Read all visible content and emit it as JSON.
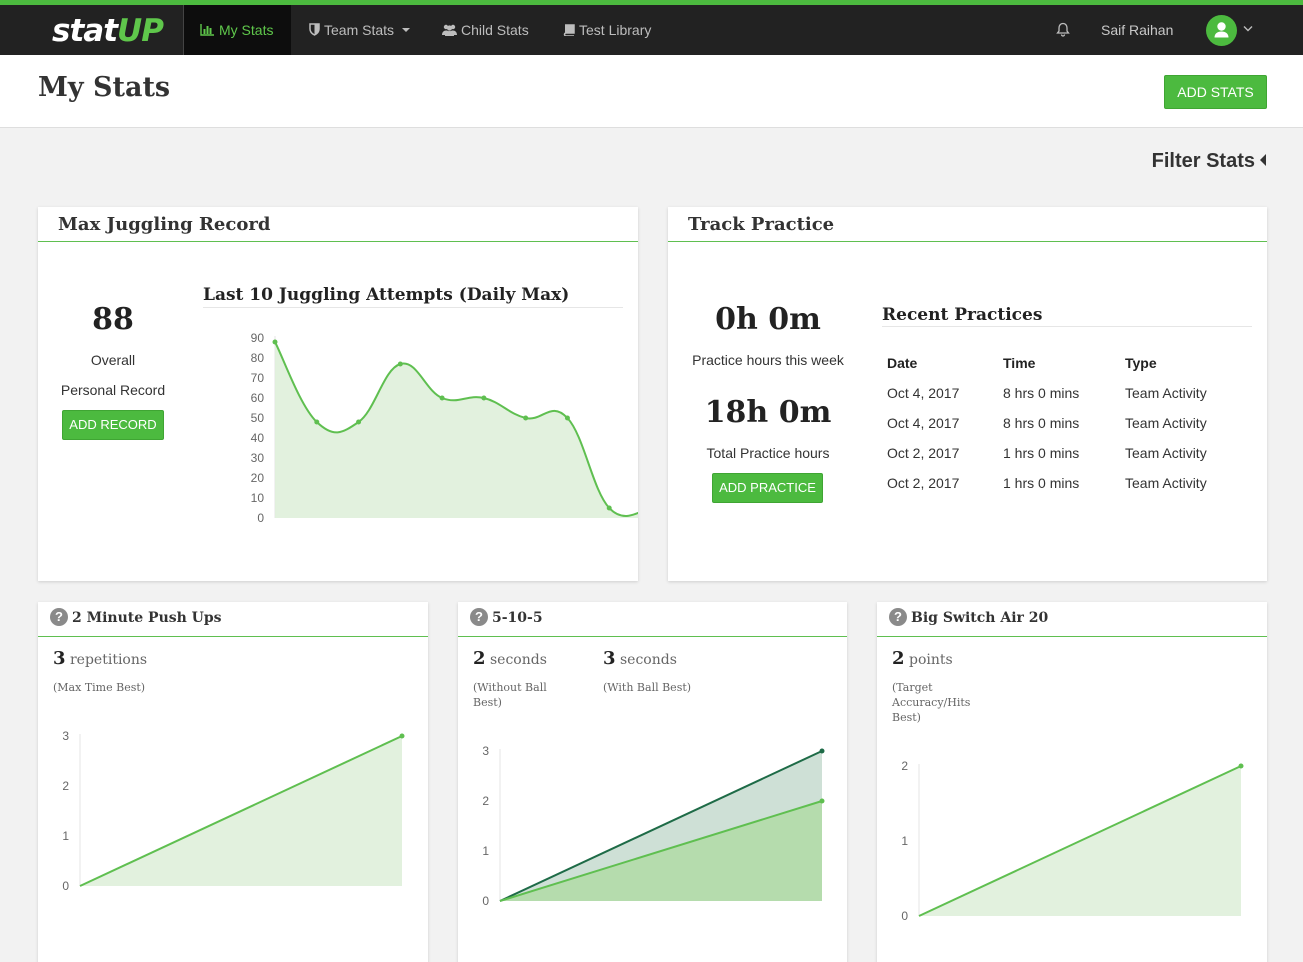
{
  "brand": {
    "part1": "stat",
    "part2": "UP"
  },
  "nav": {
    "my_stats": "My Stats",
    "team_stats": "Team Stats",
    "child_stats": "Child Stats",
    "test_library": "Test Library"
  },
  "user": {
    "name": "Saif Raihan"
  },
  "page": {
    "title": "My Stats",
    "add_stats": "ADD STATS",
    "filter": "Filter Stats"
  },
  "juggling": {
    "title": "Max Juggling Record",
    "record": "88",
    "label1": "Overall",
    "label2": "Personal Record",
    "button": "ADD RECORD",
    "chart_title": "Last 10 Juggling Attempts (Daily Max)"
  },
  "practice": {
    "title": "Track Practice",
    "week_value": "0h 0m",
    "week_label": "Practice hours this week",
    "total_value": "18h 0m",
    "total_label": "Total Practice hours",
    "button": "ADD PRACTICE",
    "recent_title": "Recent Practices",
    "columns": [
      "Date",
      "Time",
      "Type"
    ],
    "rows": [
      [
        "Oct 4, 2017",
        "8 hrs 0 mins",
        "Team Activity"
      ],
      [
        "Oct 4, 2017",
        "8 hrs 0 mins",
        "Team Activity"
      ],
      [
        "Oct 2, 2017",
        "1 hrs 0 mins",
        "Team Activity"
      ],
      [
        "Oct 2, 2017",
        "1 hrs 0 mins",
        "Team Activity"
      ]
    ]
  },
  "pushups": {
    "title": "2 Minute Push Ups",
    "value": "3",
    "unit": "repetitions",
    "note": "(Max Time Best)"
  },
  "fivetenfive": {
    "title": "5-10-5",
    "value1": "2",
    "unit1": "seconds",
    "note1": "(Without Ball Best)",
    "value2": "3",
    "unit2": "seconds",
    "note2": "(With Ball Best)"
  },
  "bigswitch": {
    "title": "Big Switch Air 20",
    "value": "2",
    "unit": "points",
    "note": "(Target Accuracy/Hits Best)"
  },
  "colors": {
    "accent": "#4cba3f",
    "fill": "#dff0da",
    "dark_series": "#1e6b47"
  },
  "chart_data": [
    {
      "type": "area",
      "title": "Last 10 Juggling Attempts (Daily Max)",
      "x": [
        1,
        2,
        3,
        4,
        5,
        6,
        7,
        8,
        9,
        10
      ],
      "values": [
        88,
        48,
        48,
        77,
        60,
        60,
        50,
        50,
        5,
        5
      ],
      "ylim": [
        0,
        90
      ],
      "yticks": [
        0,
        10,
        20,
        30,
        40,
        50,
        60,
        70,
        80,
        90
      ],
      "grid": false,
      "smooth": true
    },
    {
      "type": "area",
      "chart": "pushups",
      "x": [
        1,
        2
      ],
      "values": [
        0,
        3
      ],
      "ylim": [
        0,
        3
      ],
      "yticks": [
        0,
        1,
        2,
        3
      ]
    },
    {
      "type": "area",
      "chart": "fivetenfive",
      "x": [
        1,
        2
      ],
      "series": [
        {
          "values": [
            0,
            3
          ]
        },
        {
          "values": [
            0,
            2
          ]
        }
      ],
      "ylim": [
        0,
        3
      ],
      "yticks": [
        0,
        1,
        2,
        3
      ]
    },
    {
      "type": "area",
      "chart": "bigswitch",
      "x": [
        1,
        2
      ],
      "values": [
        0,
        2
      ],
      "ylim": [
        0,
        2
      ],
      "yticks": [
        0,
        1,
        2
      ]
    }
  ]
}
